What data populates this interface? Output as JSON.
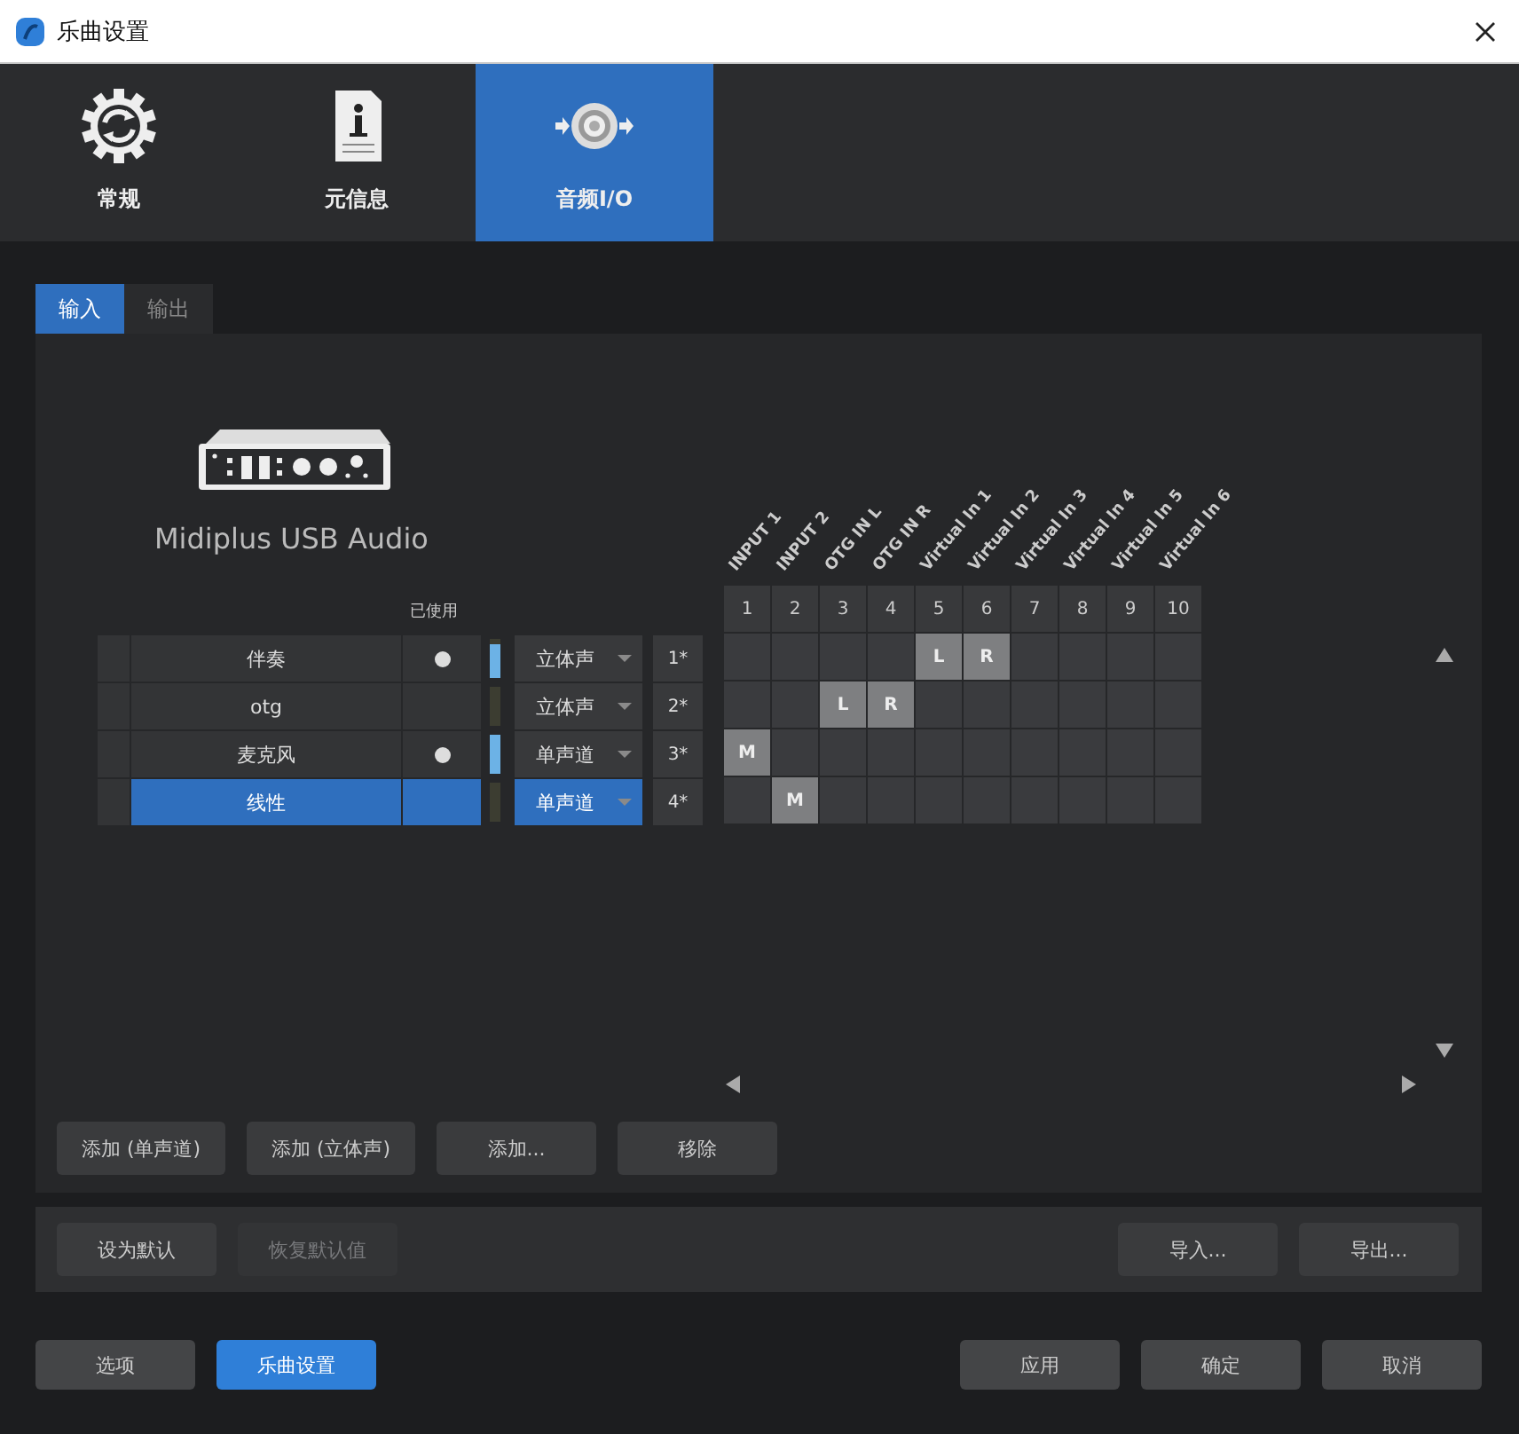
{
  "window": {
    "title": "乐曲设置"
  },
  "category_tabs": [
    {
      "label": "常规",
      "kind": "general",
      "selected": false
    },
    {
      "label": "元信息",
      "kind": "info",
      "selected": false
    },
    {
      "label": "音频I/O",
      "kind": "audio",
      "selected": true
    }
  ],
  "sub_tabs": [
    {
      "label": "输入",
      "selected": true
    },
    {
      "label": "输出",
      "selected": false
    }
  ],
  "device": {
    "name": "Midiplus USB Audio"
  },
  "channel_table": {
    "used_header": "已使用",
    "rows": [
      {
        "name": "伴奏",
        "used": true,
        "level": 0.85,
        "type": "立体声",
        "number": "1*",
        "selected": false,
        "cells": [
          {
            "assigned": false
          },
          {
            "assigned": false
          },
          {
            "assigned": false
          },
          {
            "assigned": false
          },
          {
            "assigned": true,
            "mark": "L"
          },
          {
            "assigned": true,
            "mark": "R"
          },
          {
            "assigned": false
          },
          {
            "assigned": false
          },
          {
            "assigned": false
          },
          {
            "assigned": false
          }
        ]
      },
      {
        "name": "otg",
        "used": false,
        "level": 0,
        "type": "立体声",
        "number": "2*",
        "selected": false,
        "cells": [
          {
            "assigned": false
          },
          {
            "assigned": false
          },
          {
            "assigned": true,
            "mark": "L"
          },
          {
            "assigned": true,
            "mark": "R"
          },
          {
            "assigned": false
          },
          {
            "assigned": false
          },
          {
            "assigned": false
          },
          {
            "assigned": false
          },
          {
            "assigned": false
          },
          {
            "assigned": false
          }
        ]
      },
      {
        "name": "麦克风",
        "used": true,
        "level": 1,
        "type": "单声道",
        "number": "3*",
        "selected": false,
        "cells": [
          {
            "assigned": true,
            "mark": "M"
          },
          {
            "assigned": false
          },
          {
            "assigned": false
          },
          {
            "assigned": false
          },
          {
            "assigned": false
          },
          {
            "assigned": false
          },
          {
            "assigned": false
          },
          {
            "assigned": false
          },
          {
            "assigned": false
          },
          {
            "assigned": false
          }
        ]
      },
      {
        "name": "线性",
        "used": false,
        "level": 0,
        "type": "单声道",
        "number": "4*",
        "selected": true,
        "cells": [
          {
            "assigned": false
          },
          {
            "assigned": true,
            "mark": "M"
          },
          {
            "assigned": false
          },
          {
            "assigned": false
          },
          {
            "assigned": false
          },
          {
            "assigned": false
          },
          {
            "assigned": false
          },
          {
            "assigned": false
          },
          {
            "assigned": false
          },
          {
            "assigned": false
          }
        ]
      }
    ],
    "columns": [
      {
        "label": "INPUT 1",
        "number": "1"
      },
      {
        "label": "INPUT 2",
        "number": "2"
      },
      {
        "label": "OTG IN L",
        "number": "3"
      },
      {
        "label": "OTG IN R",
        "number": "4"
      },
      {
        "label": "Virtual In 1",
        "number": "5"
      },
      {
        "label": "Virtual In 2",
        "number": "6"
      },
      {
        "label": "Virtual In 3",
        "number": "7"
      },
      {
        "label": "Virtual In 4",
        "number": "8"
      },
      {
        "label": "Virtual In 5",
        "number": "9"
      },
      {
        "label": "Virtual In 6",
        "number": "10"
      }
    ]
  },
  "panel_buttons": [
    "添加 (单声道)",
    "添加 (立体声)",
    "添加...",
    "移除"
  ],
  "defaults_bar": {
    "left": [
      {
        "label": "设为默认",
        "disabled": false
      },
      {
        "label": "恢复默认值",
        "disabled": true
      }
    ],
    "right": [
      {
        "label": "导入...",
        "disabled": false
      },
      {
        "label": "导出...",
        "disabled": false
      }
    ]
  },
  "footer": {
    "left": [
      {
        "label": "选项",
        "selected": false
      },
      {
        "label": "乐曲设置",
        "selected": true
      }
    ],
    "right": [
      "应用",
      "确定",
      "取消"
    ]
  }
}
